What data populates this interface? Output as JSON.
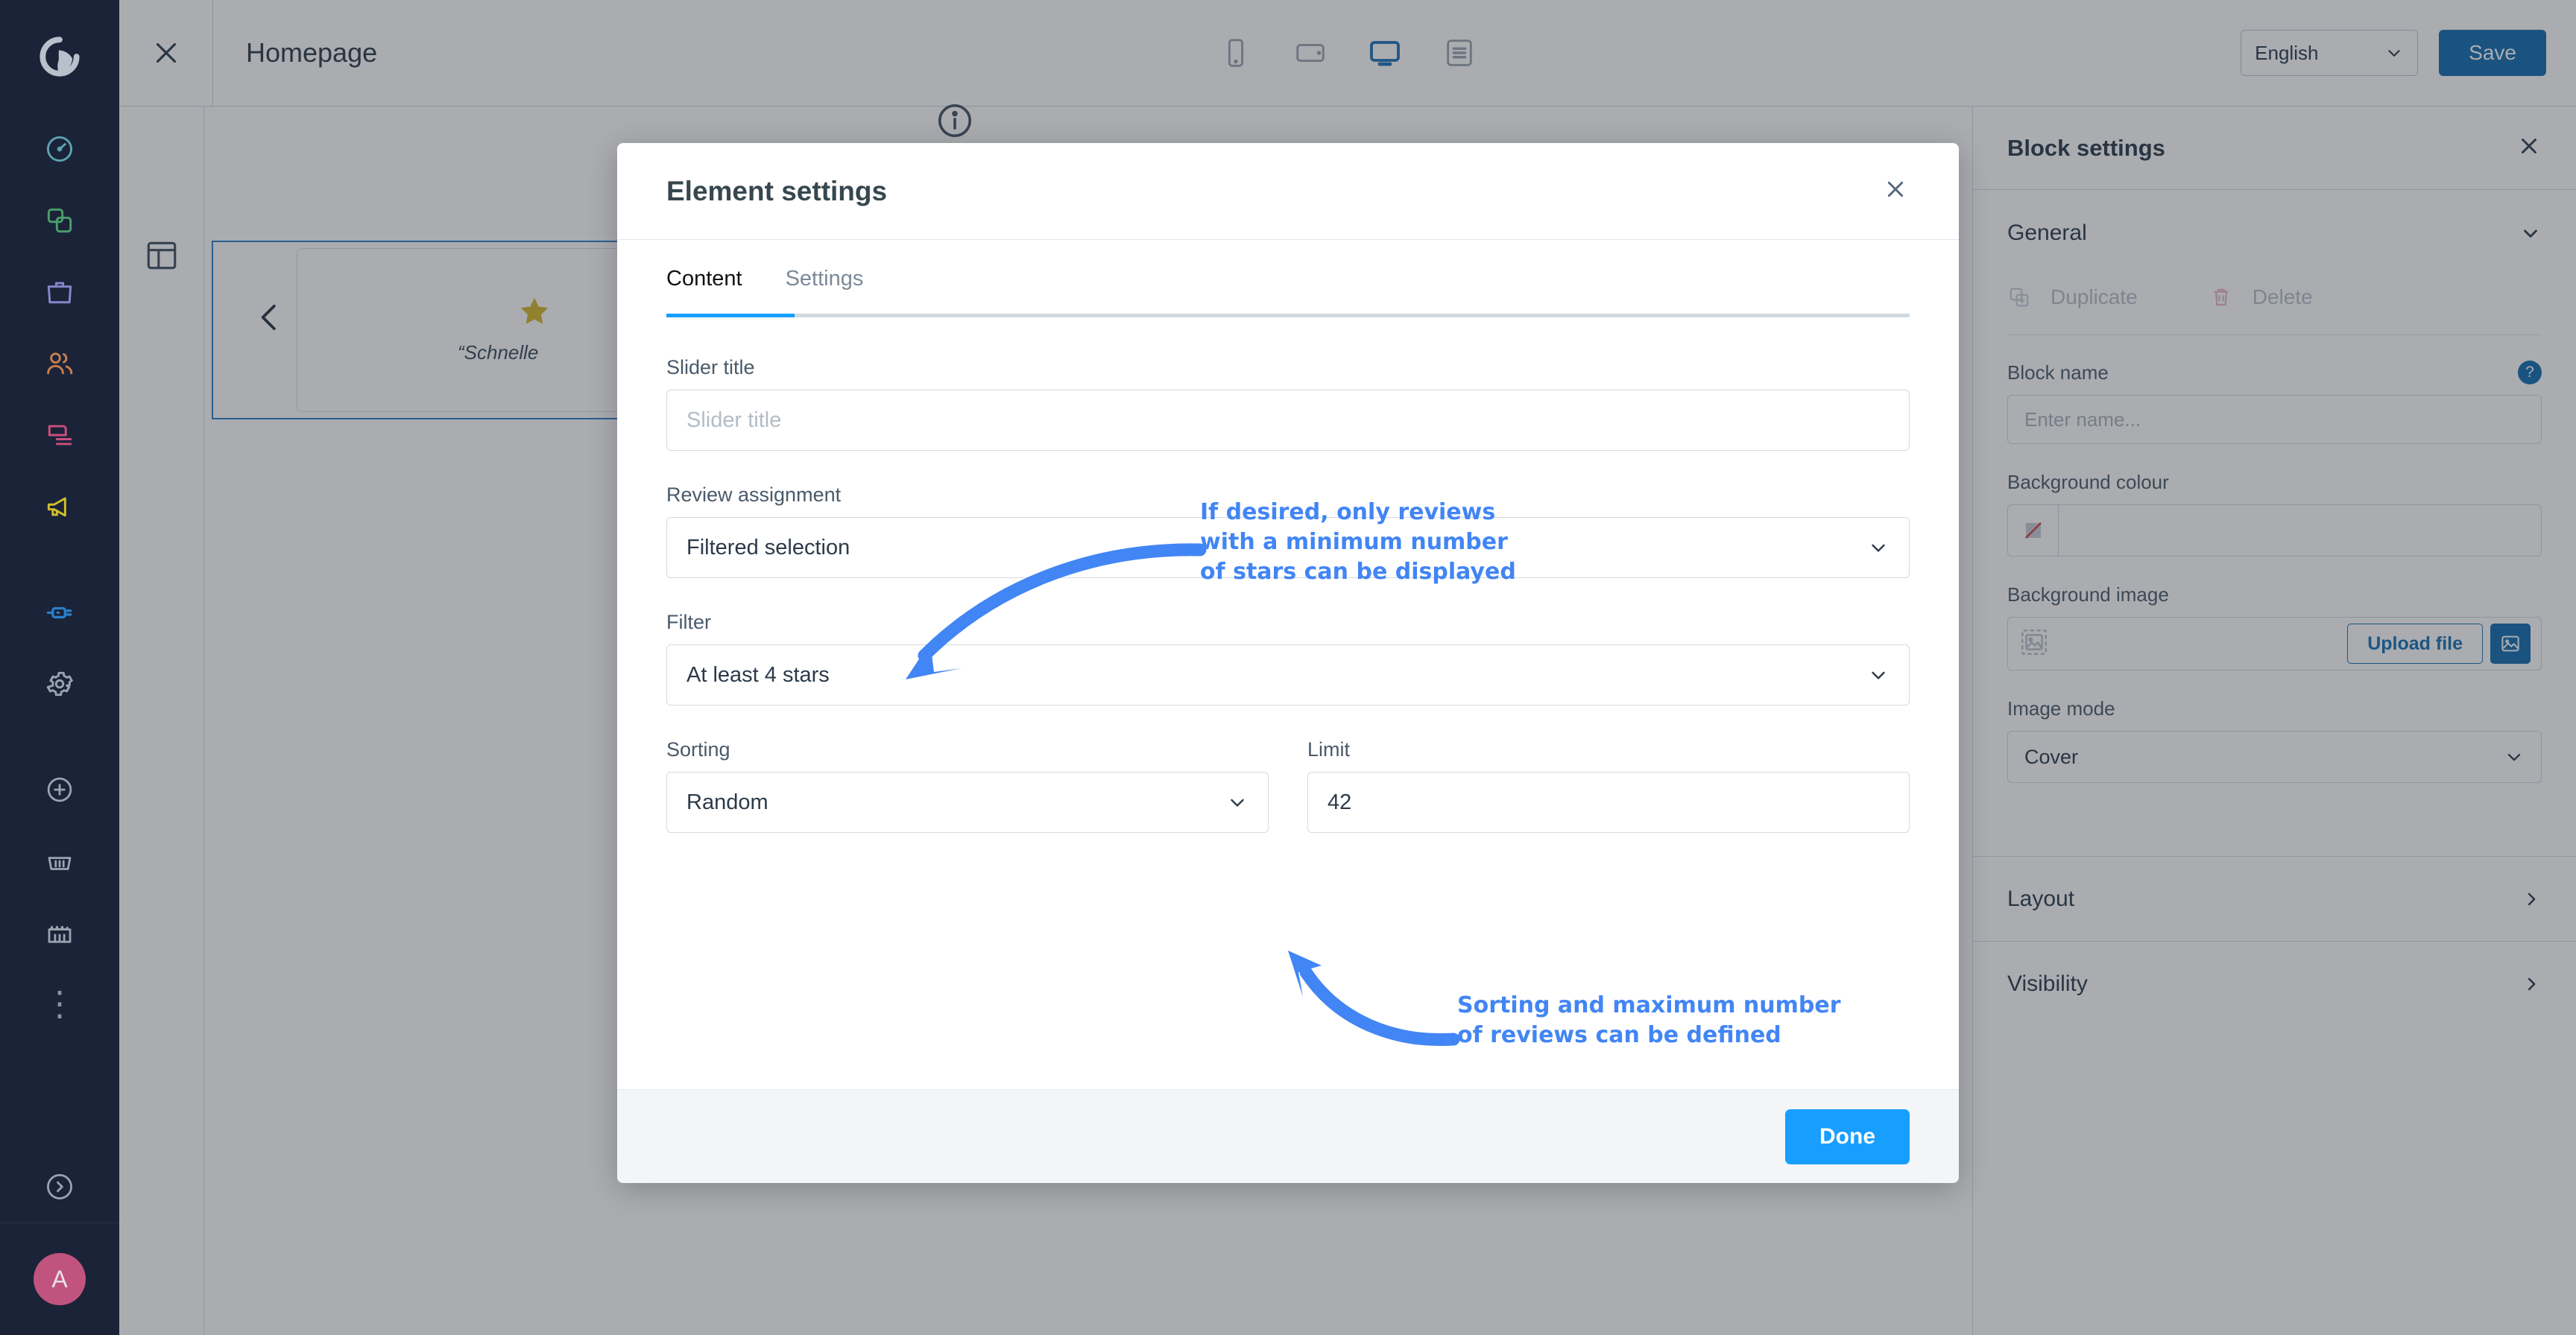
{
  "app": {
    "brand_icon": "shopware-logo-icon"
  },
  "left_nav": {
    "items": [
      {
        "name": "dashboard",
        "icon": "speedometer-icon",
        "color": "#5ba4b0"
      },
      {
        "name": "catalogues",
        "icon": "copy-squares-icon",
        "color": "#4c9e6b"
      },
      {
        "name": "orders",
        "icon": "shopping-bag-icon",
        "color": "#8188c9"
      },
      {
        "name": "customers",
        "icon": "people-icon",
        "color": "#c77f4a"
      },
      {
        "name": "content",
        "icon": "content-layers-icon",
        "color": "#c94f7c"
      },
      {
        "name": "marketing",
        "icon": "megaphone-icon",
        "color": "#cfbf29"
      },
      {
        "name": "extensions",
        "icon": "plug-icon",
        "color": "#2a7fc9"
      },
      {
        "name": "settings",
        "icon": "gear-icon",
        "color": "#9aa4b0"
      },
      {
        "name": "add",
        "icon": "plus-circle-icon",
        "color": "#9aa4b0"
      },
      {
        "name": "basket",
        "icon": "basket-icon",
        "color": "#9aa4b0"
      },
      {
        "name": "store",
        "icon": "store-icon",
        "color": "#9aa4b0"
      },
      {
        "name": "more",
        "icon": "more-vertical-icon",
        "color": "#8a93a6"
      }
    ],
    "expand_icon": "chevron-right-circle-icon",
    "avatar_initial": "A",
    "avatar_color": "#c0547f"
  },
  "topbar": {
    "close_icon": "close-icon",
    "title": "Homepage",
    "devices": [
      {
        "label": "mobile",
        "icon": "mobile-icon",
        "active": false
      },
      {
        "label": "tablet",
        "icon": "tablet-icon",
        "active": false
      },
      {
        "label": "desktop",
        "icon": "desktop-icon",
        "active": true
      },
      {
        "label": "form",
        "icon": "form-view-icon",
        "active": false
      }
    ],
    "language": "English",
    "language_chevron": "chevron-down-icon",
    "save_label": "Save",
    "save_color": "#0f6cb0"
  },
  "canvas": {
    "section_icon": "layout-columns-icon",
    "info_icon": "info-circle-icon",
    "slider_prev_icon": "chevron-left-icon",
    "star_icon": "star-icon",
    "review_quote": "“Schnelle",
    "selection_color": "#2a7fc9"
  },
  "block_settings": {
    "title": "Block settings",
    "close_icon": "close-icon",
    "sections": {
      "general": {
        "label": "General",
        "chevron": "chevron-down-icon",
        "duplicate_label": "Duplicate",
        "duplicate_icon": "duplicate-icon",
        "delete_label": "Delete",
        "delete_icon": "trash-icon",
        "block_name_label": "Block name",
        "block_name_placeholder": "Enter name...",
        "help_icon": "question-mark-icon",
        "background_colour_label": "Background colour",
        "background_colour_swatch_icon": "no-colour-icon",
        "background_image_label": "Background image",
        "background_image_placeholder_icon": "image-placeholder-icon",
        "upload_label": "Upload file",
        "media_icon": "open-media-icon",
        "image_mode_label": "Image mode",
        "image_mode_value": "Cover",
        "image_mode_chevron": "chevron-down-icon"
      }
    },
    "collapsed": [
      {
        "label": "Layout",
        "chevron": "chevron-right-icon"
      },
      {
        "label": "Visibility",
        "chevron": "chevron-right-icon"
      }
    ]
  },
  "modal": {
    "title": "Element settings",
    "close_icon": "close-icon",
    "tabs": [
      {
        "label": "Content",
        "active": true
      },
      {
        "label": "Settings",
        "active": false
      }
    ],
    "tab_accent": "#189eff",
    "fields": {
      "slider_title": {
        "label": "Slider title",
        "value": "",
        "placeholder": "Slider title"
      },
      "review_assignment": {
        "label": "Review assignment",
        "value": "Filtered selection",
        "chevron": "chevron-down-icon"
      },
      "filter": {
        "label": "Filter",
        "value": "At least 4 stars",
        "chevron": "chevron-down-icon"
      },
      "sorting": {
        "label": "Sorting",
        "value": "Random",
        "chevron": "chevron-down-icon"
      },
      "limit": {
        "label": "Limit",
        "value": "42"
      }
    },
    "done_label": "Done",
    "done_color": "#189eff"
  },
  "annotations": {
    "colour": "#4285f4",
    "items": [
      {
        "name": "filter-annotation",
        "lines": [
          "If desired, only reviews",
          "with a minimum number",
          "of stars can be displayed"
        ]
      },
      {
        "name": "sorting-annotation",
        "lines": [
          "Sorting and maximum number",
          "of reviews can be defined"
        ]
      }
    ]
  }
}
